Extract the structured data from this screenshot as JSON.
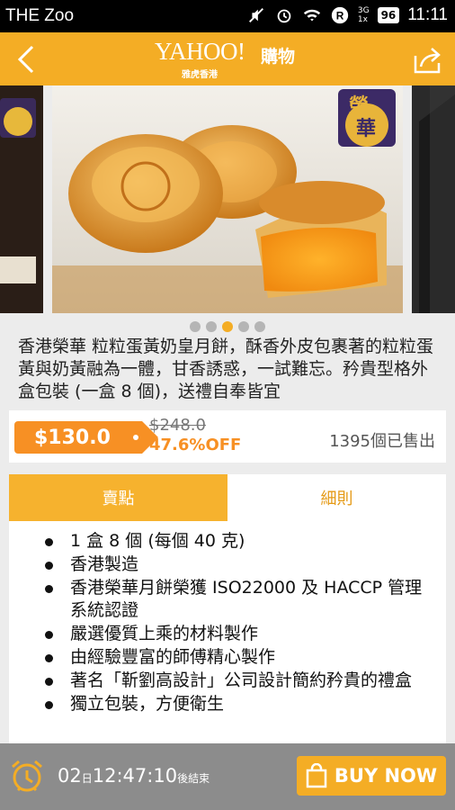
{
  "status_bar": {
    "carrier": "THE Zoo",
    "battery": "96",
    "time": "11:11",
    "network": "3G",
    "network_sub": "1x"
  },
  "app_bar": {
    "logo_main": "YAHOO!",
    "logo_shop": "購物",
    "logo_sub": "雅虎香港",
    "back_icon": "back-chevron-icon",
    "share_icon": "share-icon"
  },
  "gallery": {
    "brand_mark_1": "榮",
    "brand_mark_2": "華",
    "dots": 5,
    "active_index": 2
  },
  "product": {
    "description": "香港榮華 粒粒蛋黃奶皇月餅，酥香外皮包裹著的粒粒蛋黃與奶黃融為一體，甘香誘惑，一試難忘。矜貴型格外盒包裝 (一盒 8 個)，送禮自奉皆宜"
  },
  "price": {
    "current": "$130.0",
    "original": "$248.0",
    "discount": "47.6%OFF",
    "sold": "1395個已售出"
  },
  "tabs": [
    {
      "label": "賣點"
    },
    {
      "label": "細則"
    }
  ],
  "features": [
    "1 盒 8 個 (每個 40 克)",
    "香港製造",
    "香港榮華月餅榮獲 ISO22000 及 HACCP 管理系統認證",
    "嚴選優質上乘的材料製作",
    "由經驗豐富的師傅精心製作",
    "著名「靳劉高設計」公司設計簡約矜貴的禮盒",
    "獨立包裝，方便衛生"
  ],
  "bottom_bar": {
    "days": "02",
    "day_unit": "日",
    "time": "12:47:10",
    "suffix": "後結束",
    "buy_label": "BUY NOW"
  },
  "colors": {
    "accent": "#f4ad25",
    "price_tag": "#f79024",
    "bottom_bar": "#8c8c8c"
  }
}
